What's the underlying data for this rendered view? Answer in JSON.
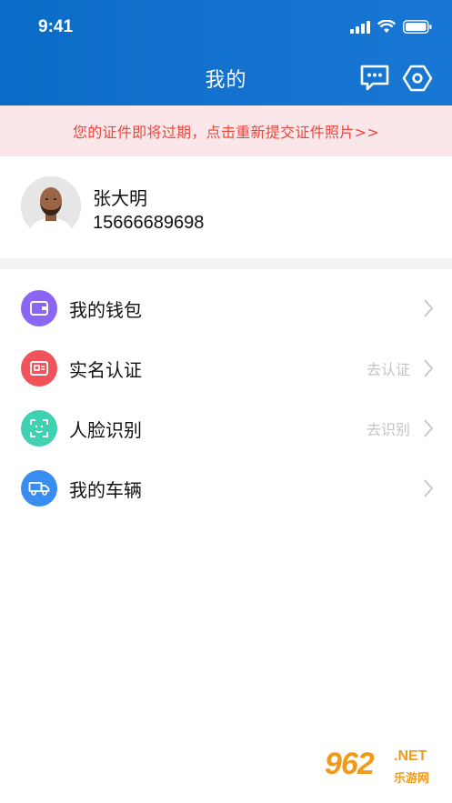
{
  "status_bar": {
    "time": "9:41"
  },
  "header": {
    "title": "我的",
    "message_icon": "message-icon",
    "settings_icon": "settings-hex-icon"
  },
  "notice": {
    "text": "您的证件即将过期，点击重新提交证件照片>>"
  },
  "profile": {
    "name": "张大明",
    "phone": "15666689698"
  },
  "menu": [
    {
      "label": "我的钱包",
      "hint": "",
      "icon": "wallet-icon",
      "color": "#8b66f5"
    },
    {
      "label": "实名认证",
      "hint": "去认证",
      "icon": "id-card-icon",
      "color": "#f0545a"
    },
    {
      "label": "人脸识别",
      "hint": "去识别",
      "icon": "face-scan-icon",
      "color": "#3fd1b0"
    },
    {
      "label": "我的车辆",
      "hint": "",
      "icon": "truck-icon",
      "color": "#3a8df0"
    }
  ],
  "watermark": {
    "number": "962",
    "net": ".NET",
    "site": "乐游网"
  },
  "colors": {
    "header": "#0a6cc6",
    "notice_bg": "#fbe7e9",
    "notice_text": "#e8473d"
  }
}
